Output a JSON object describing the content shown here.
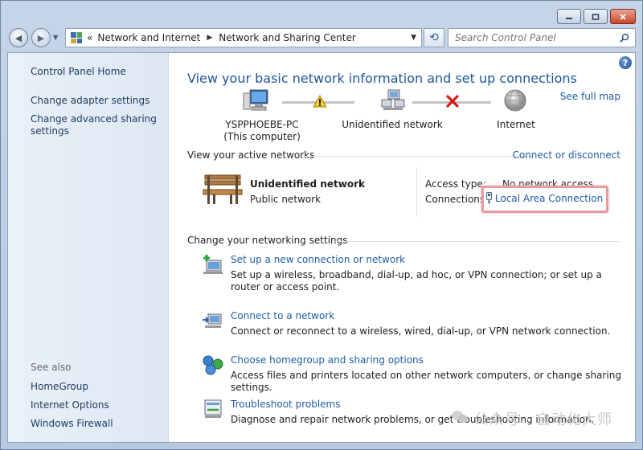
{
  "window": {
    "caption": {
      "minimize": "minimize",
      "maximize": "maximize",
      "close": "close"
    }
  },
  "address": {
    "breadcrumb": [
      "Network and Internet",
      "Network and Sharing Center"
    ],
    "chevrons": "«"
  },
  "search": {
    "placeholder": "Search Control Panel"
  },
  "sidebar": {
    "home": "Control Panel Home",
    "adapter": "Change adapter settings",
    "advanced": "Change advanced sharing settings",
    "see_also": "See also",
    "links": [
      "HomeGroup",
      "Internet Options",
      "Windows Firewall"
    ]
  },
  "main": {
    "title": "View your basic network information and set up connections",
    "see_full_map": "See full map",
    "map": {
      "computer": "YSPPHOEBE-PC",
      "computer_sub": "(This computer)",
      "network": "Unidentified network",
      "internet": "Internet"
    },
    "active": {
      "heading": "View your active networks",
      "connect_link": "Connect or disconnect",
      "network_name": "Unidentified network",
      "network_type": "Public network",
      "access_label": "Access type:",
      "access_value": "No network access",
      "connections_label": "Connections:",
      "connection_value": "Local Area Connection"
    },
    "change": {
      "heading": "Change your networking settings",
      "tasks": [
        {
          "link": "Set up a new connection or network",
          "desc": "Set up a wireless, broadband, dial-up, ad hoc, or VPN connection; or set up a router or access point."
        },
        {
          "link": "Connect to a network",
          "desc": "Connect or reconnect to a wireless, wired, dial-up, or VPN network connection."
        },
        {
          "link": "Choose homegroup and sharing options",
          "desc": "Access files and printers located on other network computers, or change sharing settings."
        },
        {
          "link": "Troubleshoot problems",
          "desc": "Diagnose and repair network problems, or get troubleshooting information."
        }
      ]
    }
  },
  "watermark": {
    "text": "公众号 · 自动化大师"
  },
  "colors": {
    "link": "#1f5ca6",
    "title": "#1e5598",
    "highlight_border": "#e89aa0"
  }
}
